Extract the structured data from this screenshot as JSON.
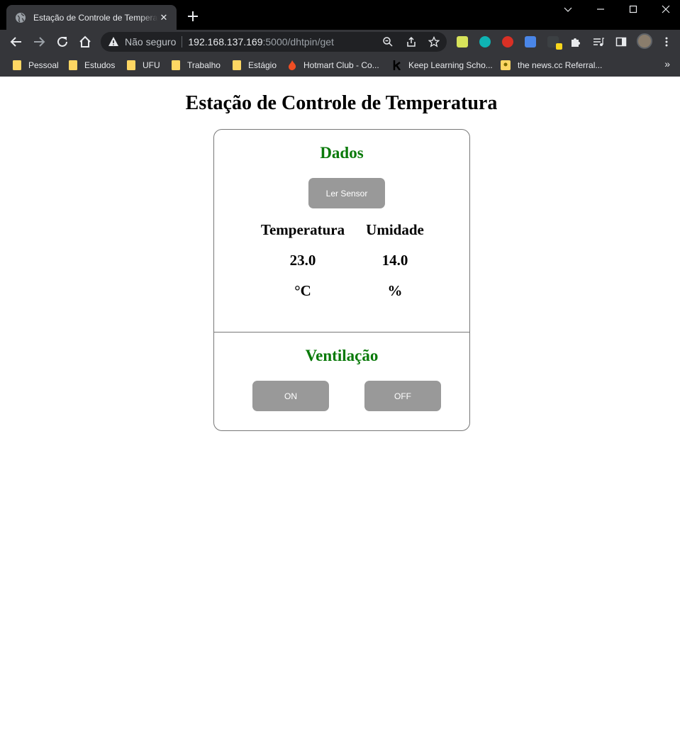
{
  "browser": {
    "tab_title": "Estação de Controle de Temperatura",
    "tab_close": "✕",
    "new_tab": "+",
    "security_label": "Não seguro",
    "url_host": "192.168.137.169",
    "url_rest": ":5000/dhtpin/get",
    "bookmarks": [
      "Pessoal",
      "Estudos",
      "UFU",
      "Trabalho",
      "Estágio",
      "Hotmart Club - Co...",
      "Keep Learning Scho...",
      "the news.cc Referral..."
    ],
    "bookmarks_more": "»",
    "icons": {
      "back": "back-arrow-icon",
      "forward": "forward-arrow-icon",
      "reload": "reload-icon",
      "home": "home-icon",
      "warning": "warning-icon",
      "zoom": "zoom-icon",
      "share": "share-icon",
      "star": "star-icon",
      "extensions": "puzzle-icon",
      "menu": "kebab-menu-icon"
    }
  },
  "page": {
    "title": "Estação de Controle de Temperatura",
    "dados": {
      "heading": "Dados",
      "read_button": "Ler Sensor",
      "temperature": {
        "label": "Temperatura",
        "value": "23.0",
        "unit": "°C"
      },
      "humidity": {
        "label": "Umidade",
        "value": "14.0",
        "unit": "%"
      }
    },
    "ventilacao": {
      "heading": "Ventilação",
      "on_button": "ON",
      "off_button": "OFF"
    }
  },
  "colors": {
    "accent_green": "#0a7a0a",
    "button_gray": "#999999",
    "chrome_dark": "#35363a"
  }
}
